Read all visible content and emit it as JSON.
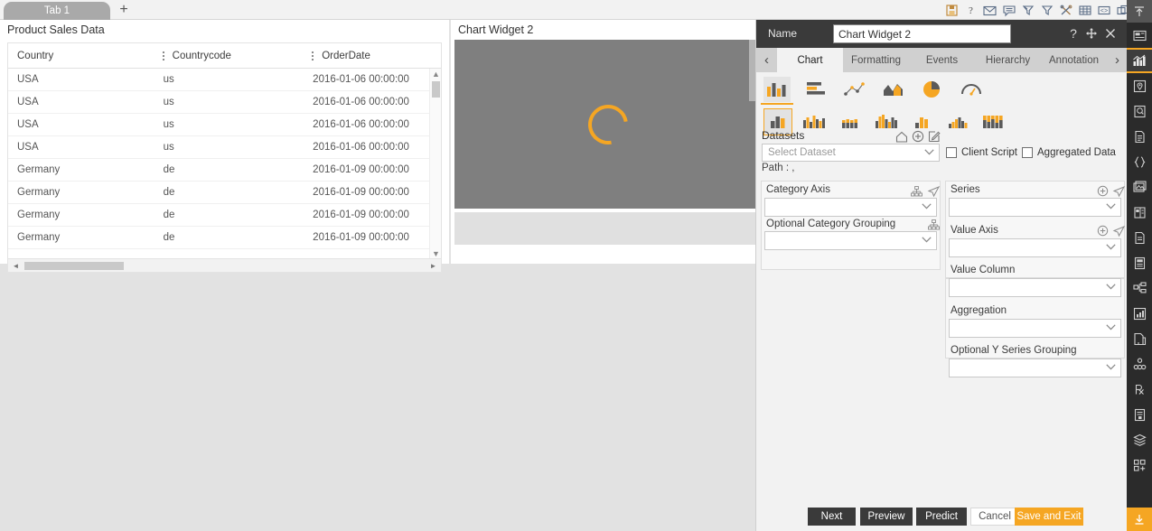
{
  "topbar": {
    "tab_label": "Tab 1",
    "add_tab_label": "+",
    "icons": [
      "save-icon",
      "help-icon",
      "mail-icon",
      "comment-icon",
      "clear-filter-icon",
      "filter-icon",
      "tools-icon",
      "table-icon",
      "code-icon",
      "copy-icon",
      "run-icon"
    ]
  },
  "sales_widget": {
    "title": "Product Sales Data",
    "columns": [
      "Country",
      "Countrycode",
      "OrderDate"
    ],
    "rows": [
      {
        "country": "USA",
        "countrycode": "us",
        "orderdate": "2016-01-06 00:00:00"
      },
      {
        "country": "USA",
        "countrycode": "us",
        "orderdate": "2016-01-06 00:00:00"
      },
      {
        "country": "USA",
        "countrycode": "us",
        "orderdate": "2016-01-06 00:00:00"
      },
      {
        "country": "USA",
        "countrycode": "us",
        "orderdate": "2016-01-06 00:00:00"
      },
      {
        "country": "Germany",
        "countrycode": "de",
        "orderdate": "2016-01-09 00:00:00"
      },
      {
        "country": "Germany",
        "countrycode": "de",
        "orderdate": "2016-01-09 00:00:00"
      },
      {
        "country": "Germany",
        "countrycode": "de",
        "orderdate": "2016-01-09 00:00:00"
      },
      {
        "country": "Germany",
        "countrycode": "de",
        "orderdate": "2016-01-09 00:00:00"
      }
    ]
  },
  "chart_widget": {
    "title": "Chart Widget 2",
    "state": "loading",
    "spinner_color": "#f5a623",
    "background_color": "#7f7f7f"
  },
  "panel": {
    "name_label": "Name",
    "name_value": "Chart Widget 2",
    "help_icon": "?",
    "move_icon": "move-icon",
    "close_icon": "close-icon",
    "nav_prev": "‹",
    "nav_next": "›",
    "tabs": [
      {
        "label": "Chart",
        "active": true
      },
      {
        "label": "Formatting",
        "active": false
      },
      {
        "label": "Events",
        "active": false
      },
      {
        "label": "Hierarchy",
        "active": false
      },
      {
        "label": "Annotation",
        "active": false
      }
    ],
    "chart_types_row1": [
      "column-chart-icon",
      "bar-chart-icon",
      "scatter-chart-icon",
      "area-chart-icon",
      "pie-chart-icon",
      "gauge-chart-icon"
    ],
    "chart_types_row2": [
      "column-basic-icon",
      "column-grouped-icon",
      "column-stacked-icon",
      "column-clustered-icon",
      "column-range-icon",
      "column-multi-icon",
      "column-full-icon"
    ],
    "selected_row1": 0,
    "selected_row2": 0,
    "datasets_label": "Datasets",
    "dataset_placeholder": "Select Dataset",
    "dataset_value": "",
    "path_label": "Path :   ,",
    "client_script_label": "Client Script",
    "aggregated_data_label": "Aggregated Data",
    "client_script_checked": false,
    "aggregated_data_checked": false,
    "fields": {
      "category_axis": {
        "label": "Category Axis",
        "value": ""
      },
      "optional_category_grouping": {
        "label": "Optional Category Grouping",
        "value": ""
      },
      "series": {
        "label": "Series",
        "value": ""
      },
      "value_axis": {
        "label": "Value Axis",
        "value": ""
      },
      "value_column": {
        "label": "Value Column",
        "value": ""
      },
      "aggregation": {
        "label": "Aggregation",
        "value": ""
      },
      "optional_y_series_grouping": {
        "label": "Optional Y Series Grouping",
        "value": ""
      }
    },
    "buttons": [
      {
        "label": "Next",
        "style": "dark"
      },
      {
        "label": "Preview",
        "style": "dark"
      },
      {
        "label": "Predict",
        "style": "dark"
      },
      {
        "label": "Cancel",
        "style": "light"
      },
      {
        "label": "Save and Exit",
        "style": "accent"
      }
    ]
  },
  "rail": {
    "top_icon": "collapse-up-icon",
    "items": [
      "widget-icon",
      "chart-icon",
      "map-icon",
      "report-icon",
      "document-icon",
      "json-icon",
      "image-icon",
      "form-icon",
      "page-icon",
      "note-icon",
      "hierarchy-icon",
      "analytics-icon",
      "file-copy-icon",
      "cube-icon",
      "prescription-icon",
      "script-icon",
      "layers-icon",
      "add-component-icon"
    ],
    "selected_index": 1,
    "bottom_icon": "download-icon"
  },
  "colors": {
    "accent": "#f5a623",
    "panel_header": "#3a3a3a",
    "panel_bg": "#f2f2f2",
    "canvas_bg": "#e2e2e2",
    "rail_bg": "#2b2b2b"
  }
}
